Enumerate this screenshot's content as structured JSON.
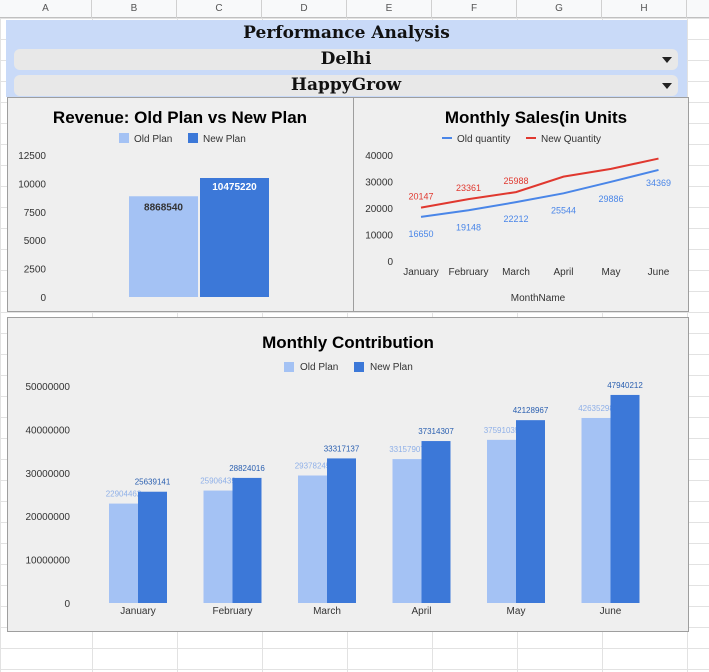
{
  "columns": [
    "A",
    "B",
    "C",
    "D",
    "E",
    "F",
    "G",
    "H"
  ],
  "header": {
    "title": "Performance Analysis",
    "city": "Delhi",
    "brand": "HappyGrow"
  },
  "colors": {
    "old": "#a4c2f4",
    "new": "#3c78d8",
    "old_line": "#4a86e8",
    "new_line": "#e0382f"
  },
  "chart_data": [
    {
      "type": "bar",
      "title": "Revenue: Old Plan vs New Plan",
      "series": [
        {
          "name": "Old Plan",
          "values": [
            8868540
          ]
        },
        {
          "name": "New Plan",
          "values": [
            10475220
          ]
        }
      ],
      "yticks": [
        "0",
        "2500",
        "5000",
        "7500",
        "10000",
        "12500"
      ],
      "ylim": [
        0,
        12500000
      ],
      "legend": "top"
    },
    {
      "type": "line",
      "title": "Monthly Sales(in Units",
      "x": [
        "January",
        "February",
        "March",
        "April",
        "May",
        "June"
      ],
      "xlabel": "MonthName",
      "series": [
        {
          "name": "Old quantity",
          "values": [
            16650,
            19148,
            22212,
            25544,
            29886,
            34369
          ]
        },
        {
          "name": "New Quantity",
          "values": [
            20147,
            23361,
            25988,
            31833,
            34760,
            38653
          ]
        }
      ],
      "new_labels": [
        "20147",
        "23361",
        "25988"
      ],
      "yticks": [
        "0",
        "10000",
        "20000",
        "30000",
        "40000"
      ],
      "ylim": [
        0,
        40000
      ],
      "legend": "top"
    },
    {
      "type": "bar",
      "title": "Monthly Contribution",
      "categories": [
        "January",
        "February",
        "March",
        "April",
        "May",
        "June"
      ],
      "series": [
        {
          "name": "Old Plan",
          "values": [
            22904462,
            25906439,
            29378245,
            33157907,
            37591035,
            42635298
          ]
        },
        {
          "name": "New Plan",
          "values": [
            25639141,
            28824016,
            33317137,
            37314307,
            42128967,
            47940212
          ]
        }
      ],
      "old_labels": [
        "22904462",
        "25906439",
        "29378245",
        "33157907",
        "37591035",
        "42635298"
      ],
      "new_labels": [
        "25639141",
        "28824016",
        "33317137",
        "37314307",
        "42128967",
        "47940212"
      ],
      "yticks": [
        "0",
        "10000000",
        "20000000",
        "30000000",
        "40000000",
        "50000000"
      ],
      "ylim": [
        0,
        50000000
      ],
      "legend": "top"
    }
  ]
}
